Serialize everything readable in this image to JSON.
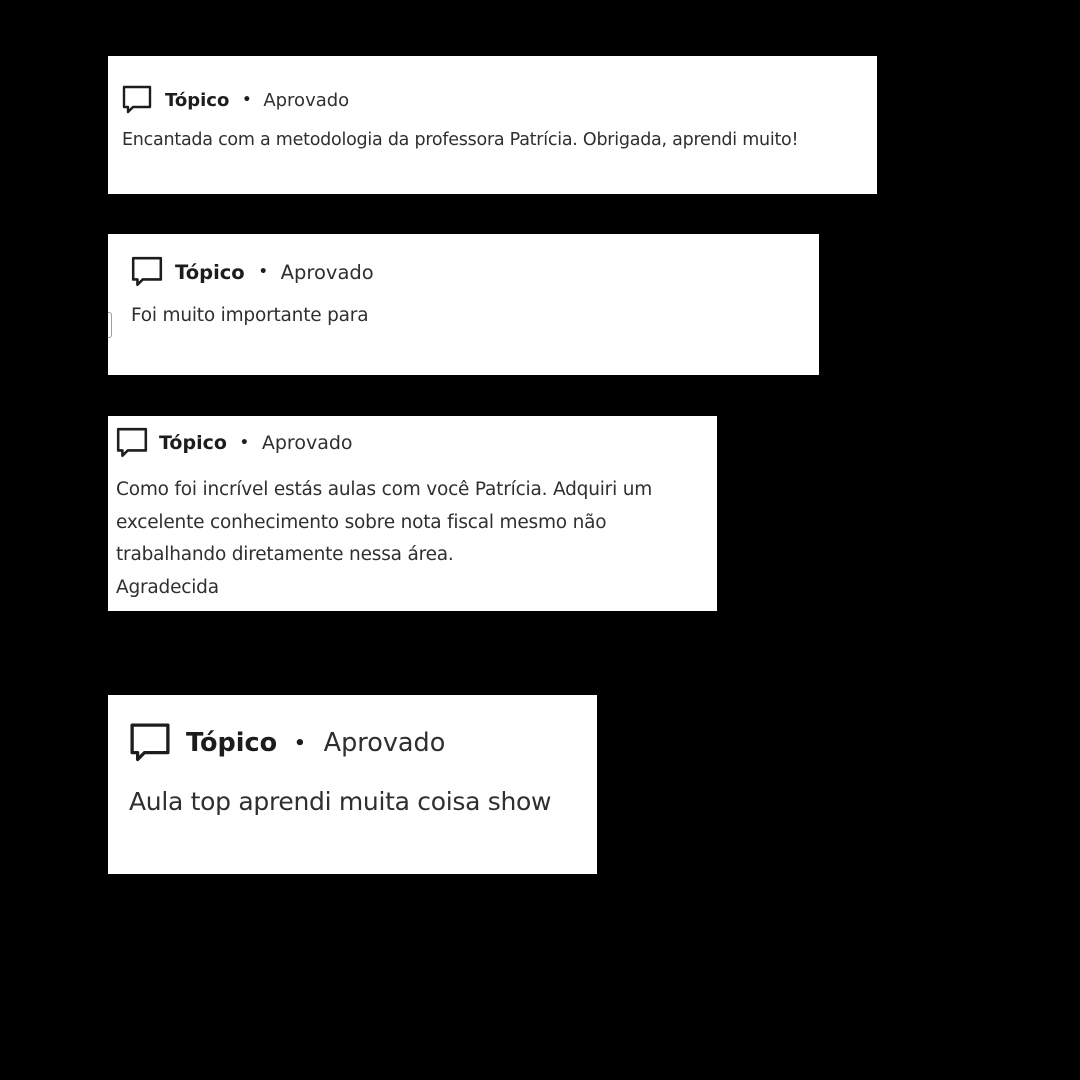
{
  "colors": {
    "background": "#000000",
    "card": "#ffffff",
    "text": "#1c1d1f"
  },
  "icon": "speech-bubble-icon",
  "cards": [
    {
      "title": "Tópico",
      "separator": "•",
      "status": "Aprovado",
      "lines": [
        "Encantada com a metodologia da professora Patrícia. Obrigada, aprendi muito!"
      ]
    },
    {
      "title": "Tópico",
      "separator": "•",
      "status": "Aprovado",
      "lines": [
        "Foi muito importante para"
      ]
    },
    {
      "title": "Tópico",
      "separator": "•",
      "status": "Aprovado",
      "lines": [
        "Como foi incrível estás aulas com você Patrícia. Adquiri um",
        "excelente conhecimento sobre nota fiscal mesmo não",
        "trabalhando diretamente nessa área.",
        "Agradecida"
      ]
    },
    {
      "title": "Tópico",
      "separator": "•",
      "status": "Aprovado",
      "lines": [
        "Aula top aprendi muita coisa show"
      ]
    }
  ]
}
